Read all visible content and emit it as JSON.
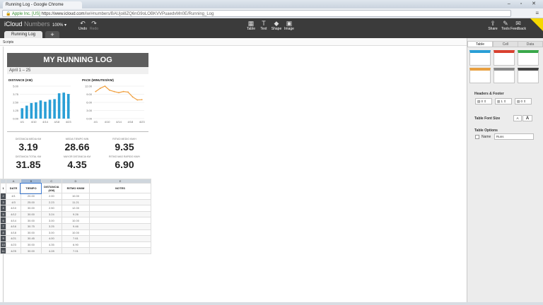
{
  "browser": {
    "tab_title": "Running Log - Google Chrome",
    "window_controls": "– ▫ ✕",
    "url_secure": "Apple Inc. [US]",
    "url_host": "https://www.icloud.com",
    "url_path": "/iw/#numbers/BAUjoi8ZQ6nG9oLOBKVVPuaedvMn0E/Running_Log",
    "menu_icon": "≡"
  },
  "app": {
    "title_a": "iCloud",
    "title_b": "Numbers",
    "zoom": "100% ▾",
    "undo": "Undo",
    "redo": "Redo",
    "tools_left": [
      {
        "label": "Table",
        "icon": "▦"
      },
      {
        "label": "Text",
        "icon": "T"
      },
      {
        "label": "Shape",
        "icon": "◆"
      },
      {
        "label": "Image",
        "icon": "▣"
      }
    ],
    "tools_right": [
      {
        "label": "Share",
        "icon": "⇪"
      },
      {
        "label": "Tools",
        "icon": "✎"
      },
      {
        "label": "Feedback",
        "icon": "✉"
      }
    ],
    "sheet_tab": "Running Log",
    "add_sheet": "+",
    "subbar_label": "Scripts"
  },
  "sheet": {
    "title": "MY RUNNING LOG",
    "date_range": "April 1 – 25",
    "dist_title": "DISTANCE (KM)",
    "pace_title": "PACE (MINUTES/KM)"
  },
  "stats": [
    {
      "label": "DISTANCIA MEDIA KM",
      "value": "3.19"
    },
    {
      "label": "MEDIA TIEMPO MIN",
      "value": "28.66"
    },
    {
      "label": "RITMO MEDIO KM/H",
      "value": "9.35"
    },
    {
      "label": "DISTANCIA TOTAL KM",
      "value": "31.85"
    },
    {
      "label": "MAYOR DISTANCIA KM",
      "value": "4.35"
    },
    {
      "label": "RITMO MAS RAPIDO KM/H",
      "value": "6.90"
    }
  ],
  "table": {
    "col_letters": [
      "A",
      "B",
      "C",
      "D",
      "E"
    ],
    "headers": [
      "DATE",
      "TIEMPO",
      "DISTANCIA (KM)",
      "RITMO KM/M",
      "NOTES"
    ],
    "rows": [
      [
        "4/1",
        "20.00",
        "2.00",
        "10.00",
        ""
      ],
      [
        "4/3",
        "25.00",
        "2.23",
        "11.21",
        ""
      ],
      [
        "4/10",
        "30.00",
        "2.50",
        "12.00",
        ""
      ],
      [
        "4/12",
        "30.00",
        "3.24",
        "9.26",
        ""
      ],
      [
        "4/14",
        "30.00",
        "3.00",
        "10.00",
        ""
      ],
      [
        "4/16",
        "30.75",
        "3.25",
        "9.46",
        ""
      ],
      [
        "4/18",
        "30.00",
        "3.00",
        "10.00",
        ""
      ],
      [
        "4/21",
        "30.45",
        "4.00",
        "7.61",
        ""
      ],
      [
        "4/23",
        "30.00",
        "4.35",
        "6.90",
        ""
      ],
      [
        "4/25",
        "30.00",
        "4.28",
        "7.01",
        ""
      ]
    ]
  },
  "chart_data": [
    {
      "type": "bar",
      "title": "DISTANCE (KM)",
      "categories": [
        "4/1",
        "4/10",
        "4/14",
        "4/18",
        "4/23"
      ],
      "values": [
        1.6,
        2.0,
        2.4,
        2.5,
        2.8,
        2.6,
        2.9,
        3.0,
        3.9,
        4.0,
        3.8
      ],
      "yticks": [
        "5.00",
        "3.75",
        "2.50",
        "1.25",
        "0.00"
      ],
      "ylim": [
        0,
        5
      ],
      "color": "#2a9fd6"
    },
    {
      "type": "line",
      "title": "PACE (MINUTES/KM)",
      "categories": [
        "4/1",
        "4/10",
        "4/14",
        "4/18",
        "4/23"
      ],
      "values": [
        10.0,
        11.2,
        12.0,
        10.5,
        10.0,
        9.6,
        10.0,
        9.8,
        8.0,
        6.9,
        7.0
      ],
      "yticks": [
        "12.00",
        "9.00",
        "6.00",
        "3.00",
        "0.00"
      ],
      "ylim": [
        0,
        12
      ],
      "color": "#f0a040"
    }
  ],
  "panel": {
    "tabs": [
      "Table",
      "Cell",
      "Data"
    ],
    "headers_footer": "Headers & Footer",
    "hf_values": [
      "0",
      "1",
      "0"
    ],
    "font_size_label": "Table Font Size",
    "font_small": "A",
    "font_large": "A",
    "options_label": "Table Options",
    "name_label": "Name",
    "name_value": "Runs"
  }
}
